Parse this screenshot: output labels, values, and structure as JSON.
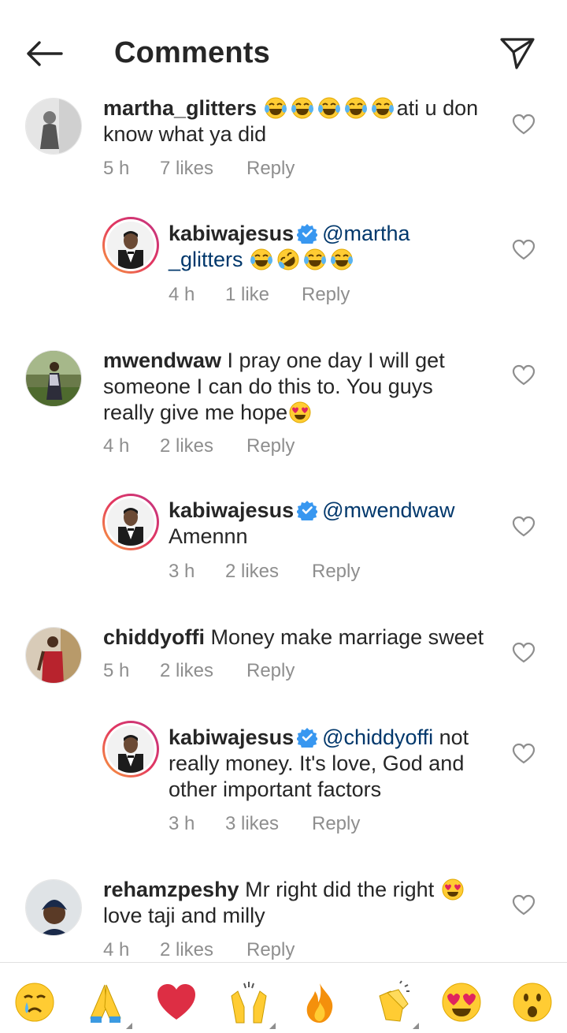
{
  "header": {
    "title": "Comments"
  },
  "comments": [
    {
      "user": "martha_glitters",
      "text_after_emoji": "ati u don know what ya did",
      "time": "5 h",
      "likes": "7 likes",
      "reply": "Reply"
    },
    {
      "user": "kabiwajesus",
      "mention_1": "@martha",
      "mention_2": "_glitters",
      "time": "4 h",
      "likes": "1 like",
      "reply": "Reply"
    },
    {
      "user": "mwendwaw",
      "line1": "I pray one day I will get",
      "line2": "someone I can do this to. You guys",
      "line3": "really give me hope",
      "time": "4 h",
      "likes": "2 likes",
      "reply": "Reply"
    },
    {
      "user": "kabiwajesus",
      "mention": "@mwendwaw",
      "line2": "Amennn",
      "time": "3 h",
      "likes": "2 likes",
      "reply": "Reply"
    },
    {
      "user": "chiddyoffi",
      "line1": "Money make marriage sweet",
      "time": "5 h",
      "likes": "2 likes",
      "reply": "Reply"
    },
    {
      "user": "kabiwajesus",
      "mention": "@chiddyoffi",
      "line1_rest": "not",
      "line2": "really money. It's love, God and",
      "line3": "other important factors",
      "time": "3 h",
      "likes": "3 likes",
      "reply": "Reply"
    },
    {
      "user": "rehamzpeshy",
      "line1": "Mr right did the right",
      "line2": "love taji and milly",
      "time": "4 h",
      "likes": "2 likes",
      "reply": "Reply"
    }
  ],
  "emoji_bar": [
    "crying-face",
    "folded-hands",
    "red-heart",
    "raising-hands",
    "fire",
    "clapping-hands",
    "heart-eyes",
    "astonished-face"
  ],
  "colors": {
    "text": "#262626",
    "meta": "#8e8e8e",
    "mention": "#00376b",
    "verified": "#3897f0",
    "heart-red": "#e0245e"
  }
}
